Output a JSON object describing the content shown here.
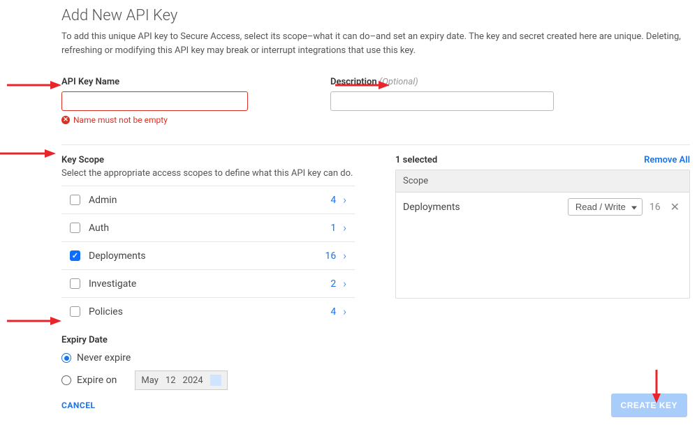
{
  "title": "Add New API Key",
  "intro": "To add this unique API key to Secure Access, select its scope–what it can do–and set an expiry date. The key and secret created here are unique. Deleting, refreshing or modifying this API key may break or interrupt integrations that use this key.",
  "fields": {
    "api_key_name": {
      "label": "API Key Name",
      "value": "",
      "error": "Name must not be empty"
    },
    "description": {
      "label": "Description",
      "optional_text": "(Optional)",
      "value": ""
    }
  },
  "key_scope": {
    "label": "Key Scope",
    "help": "Select the appropriate access scopes to define what this API key can do.",
    "items": [
      {
        "name": "Admin",
        "count": 4,
        "checked": false
      },
      {
        "name": "Auth",
        "count": 1,
        "checked": false
      },
      {
        "name": "Deployments",
        "count": 16,
        "checked": true
      },
      {
        "name": "Investigate",
        "count": 2,
        "checked": false
      },
      {
        "name": "Policies",
        "count": 4,
        "checked": false
      }
    ]
  },
  "selected": {
    "count_label": "1 selected",
    "remove_all": "Remove All",
    "column_header": "Scope",
    "rows": [
      {
        "name": "Deployments",
        "permission": "Read / Write",
        "count": 16
      }
    ]
  },
  "expiry": {
    "label": "Expiry Date",
    "never_label": "Never expire",
    "expire_on_label": "Expire on",
    "selected": "never",
    "date": {
      "month": "May",
      "day": "12",
      "year": "2024"
    }
  },
  "footer": {
    "cancel": "CANCEL",
    "create": "CREATE KEY"
  }
}
